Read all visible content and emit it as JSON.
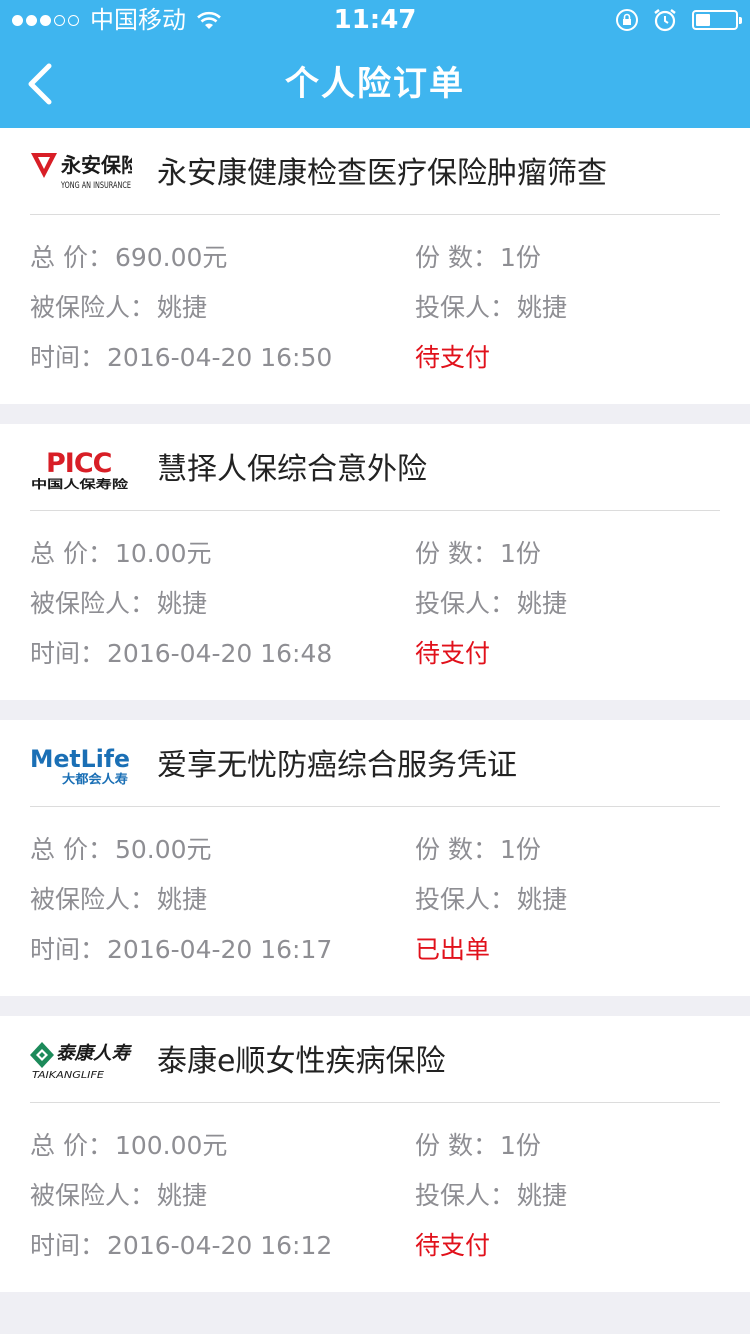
{
  "status_bar": {
    "carrier": "中国移动",
    "time": "11:47",
    "signal_dots_filled": 3,
    "signal_dots_total": 5
  },
  "nav": {
    "title": "个人险订单",
    "back_icon": "chevron-left-icon"
  },
  "labels": {
    "total": "总 价：",
    "copies": "份 数：",
    "insured": "被保险人：",
    "policyholder": "投保人：",
    "time": "时间："
  },
  "orders": [
    {
      "company": "永安保险",
      "company_en": "YONG AN INSURANCE",
      "product": "永安康健康检查医疗保险肿瘤筛查",
      "total": "690.00元",
      "copies": "1份",
      "insured": "姚捷",
      "policyholder": "姚捷",
      "time": "2016-04-20 16:50",
      "status": "待支付"
    },
    {
      "company": "PICC",
      "company_cn": "中国人保寿险",
      "product": "慧择人保综合意外险",
      "total": "10.00元",
      "copies": "1份",
      "insured": "姚捷",
      "policyholder": "姚捷",
      "time": "2016-04-20 16:48",
      "status": "待支付"
    },
    {
      "company": "MetLife",
      "company_cn": "大都会人寿",
      "product": "爱享无忧防癌综合服务凭证",
      "total": "50.00元",
      "copies": "1份",
      "insured": "姚捷",
      "policyholder": "姚捷",
      "time": "2016-04-20 16:17",
      "status": "已出单"
    },
    {
      "company": "泰康人寿",
      "company_en": "TAIKANGLIFE",
      "product": "泰康e顺女性疾病保险",
      "total": "100.00元",
      "copies": "1份",
      "insured": "姚捷",
      "policyholder": "姚捷",
      "time": "2016-04-20 16:12",
      "status": "待支付"
    }
  ],
  "colors": {
    "brand_blue": "#3fb5ef",
    "status_red": "#e1111b",
    "label_gray": "#8e8e93",
    "page_bg": "#efeff4"
  }
}
